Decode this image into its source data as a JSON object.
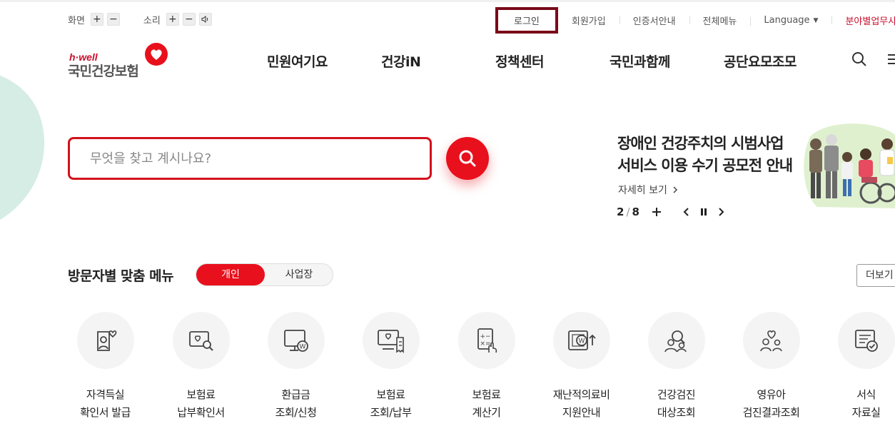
{
  "utility": {
    "screen_label": "화면",
    "sound_label": "소리",
    "plus": "+",
    "minus": "−"
  },
  "top_links": {
    "login": "로그인",
    "signup": "회원가입",
    "cert": "인증서안내",
    "sitemap": "전체메뉴",
    "language": "Language",
    "field_sites": "분야별업무사이트"
  },
  "logo": {
    "tagline": "h·well",
    "name": "국민건강보험"
  },
  "nav": {
    "items": [
      "민원여기요",
      "건강iN",
      "정책센터",
      "국민과함께",
      "공단요모조모"
    ]
  },
  "search": {
    "placeholder": "무엇을 찾고 계시나요?"
  },
  "banner": {
    "title_line1": "장애인 건강주치의 시범사업",
    "title_line2": "서비스 이용 수기 공모전 안내",
    "more": "자세히 보기",
    "page_current": "2",
    "page_sep": "/",
    "page_total": "8"
  },
  "visitor_menu": {
    "title": "방문자별 맞춤 메뉴",
    "tab_personal": "개인",
    "tab_business": "사업장",
    "more": "더보기",
    "items": [
      {
        "line1": "자격득실",
        "line2": "확인서 발급",
        "icon": "person-heart-icon"
      },
      {
        "line1": "보험료",
        "line2": "납부확인서",
        "icon": "document-search-icon"
      },
      {
        "line1": "환급금",
        "line2": "조회/신청",
        "icon": "monitor-won-icon"
      },
      {
        "line1": "보험료",
        "line2": "조회/납부",
        "icon": "computer-receipt-icon"
      },
      {
        "line1": "보험료",
        "line2": "계산기",
        "icon": "calculator-hand-icon"
      },
      {
        "line1": "재난적의료비",
        "line2": "지원안내",
        "icon": "won-support-icon"
      },
      {
        "line1": "건강검진",
        "line2": "대상조회",
        "icon": "people-search-icon"
      },
      {
        "line1": "영유아",
        "line2": "검진결과조회",
        "icon": "family-heart-icon"
      },
      {
        "line1": "서식",
        "line2": "자료실",
        "icon": "form-check-icon"
      }
    ]
  },
  "colors": {
    "brand_red": "#e8101c",
    "login_border": "#7a0a19",
    "blob": "#d6ede6"
  }
}
